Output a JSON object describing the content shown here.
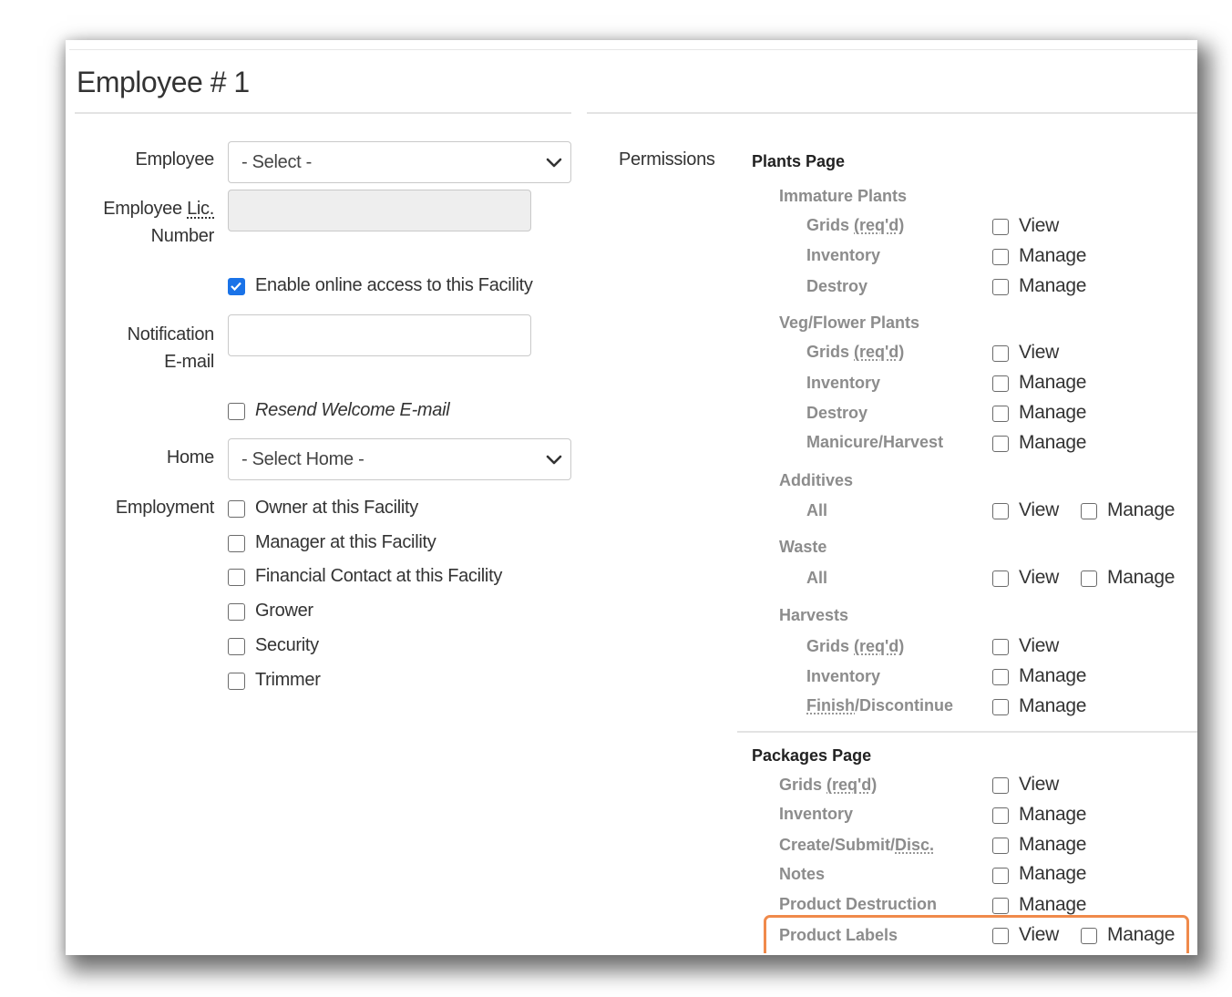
{
  "title": "Employee # 1",
  "form": {
    "employee_label": "Employee",
    "employee_select": "- Select -",
    "lic_label_1": "Employee ",
    "lic_label_lic": "Lic.",
    "lic_label_2": "Number",
    "online_access": "Enable online access to this Facility",
    "notification_label_1": "Notification",
    "notification_label_2": "E-mail",
    "resend": "Resend Welcome E-mail",
    "home_label": "Home",
    "home_select": "- Select Home -",
    "employment_label": "Employment",
    "employment": [
      "Owner at this Facility",
      "Manager at this Facility",
      "Financial Contact at this Facility",
      "Grower",
      "Security",
      "Trimmer"
    ]
  },
  "permissions": {
    "label": "Permissions",
    "plants_page": "Plants Page",
    "immature_plants": "Immature Plants",
    "veg_flower_plants": "Veg/Flower Plants",
    "additives": "Additives",
    "waste": "Waste",
    "harvests": "Harvests",
    "packages_page": "Packages Page",
    "grids_a": "Grids ",
    "reqd": "(req'd)",
    "inventory": "Inventory",
    "destroy": "Destroy",
    "manicure_harvest": "Manicure/Harvest",
    "all": "All",
    "finish_a": "Finish",
    "finish_b": "/Discontinue",
    "create_a": "Create/Submit/",
    "create_b": "Disc.",
    "notes": "Notes",
    "product_destruction": "Product Destruction",
    "product_labels": "Product Labels",
    "view": "View",
    "manage": "Manage"
  }
}
